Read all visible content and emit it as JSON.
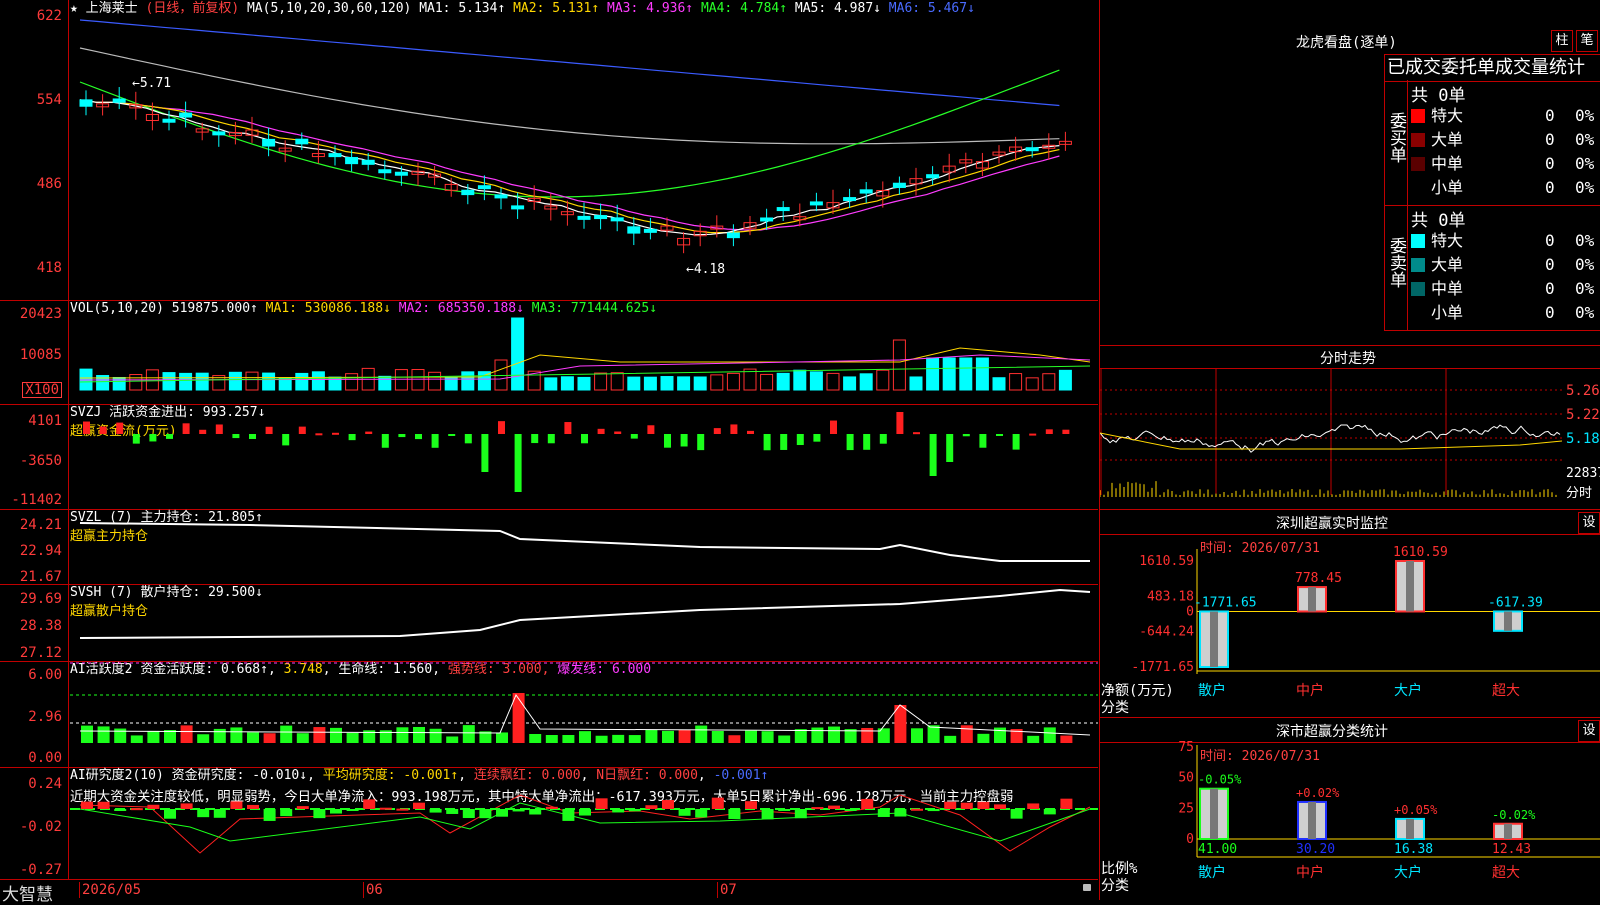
{
  "main": {
    "title_star": "★",
    "stock_name": "上海莱士",
    "period_note": "(日线，前复权)",
    "ma_label": "MA(5,10,20,30,60,120)",
    "ma1": "MA1: 5.134↑",
    "ma2": "MA2: 5.131↑",
    "ma3": "MA3: 4.936↑",
    "ma4": "MA4: 4.784↑",
    "ma5": "MA5: 4.987↓",
    "ma6": "MA6: 5.467↓",
    "ticks": [
      "622",
      "554",
      "486",
      "418"
    ],
    "high_label": "←5.71",
    "low_label": "←4.18"
  },
  "vol": {
    "label": "VOL(5,10,20)",
    "value": "519875.000↑",
    "ma1": "MA1: 530086.188↓",
    "ma2": "MA2: 685350.188↓",
    "ma3": "MA3: 771444.625↓",
    "ticks": [
      "20423",
      "10085",
      "X100"
    ]
  },
  "svzj": {
    "label": "SVZJ",
    "line1": "活跃资金进出: 993.257↓",
    "line2": "超赢资金流(万元)",
    "ticks": [
      "4101",
      "-3650",
      "-11402"
    ]
  },
  "svzl": {
    "label": "SVZL (7)",
    "line1": "主力持仓: 21.805↑",
    "line2": "超赢主力持仓",
    "ticks": [
      "24.21",
      "22.94",
      "21.67"
    ]
  },
  "svsh": {
    "label": "SVSH (7)",
    "line1": "散户持仓: 29.500↓",
    "line2": "超赢散户持仓",
    "ticks": [
      "29.69",
      "28.38",
      "27.12"
    ]
  },
  "ai1": {
    "label": "AI活跃度2",
    "a": "资金活跃度: 0.668↑",
    "b": "3.748",
    "c": "生命线: 1.560",
    "d": "强势线: 3.000",
    "e": "爆发线: 6.000",
    "ticks": [
      "6.00",
      "2.96",
      "0.00"
    ]
  },
  "ai2": {
    "label": "AI研究度2(10)",
    "a": "资金研究度: -0.010↓",
    "b": "平均研究度: -0.001↑",
    "c": "连续飘红: 0.000",
    "d": "N日飘红: 0.000",
    "e": "-0.001↑",
    "desc": "近期大资金关注度较低，明显弱势，今日大单净流入：993.198万元，其中特大单净流出：-617.393万元，大单5日累计净出-696.128万元，当前主力控盘弱",
    "ticks": [
      "0.24",
      "-0.02",
      "-0.27"
    ]
  },
  "footer": {
    "brand": "大智慧",
    "dates": [
      "2026/05",
      "06",
      "07"
    ]
  },
  "lhb": {
    "title": "龙虎看盘(逐单)",
    "btn1": "柱",
    "btn2": "笔",
    "header": "已成交委托单成交量统计",
    "buy_side": "委买单",
    "sell_side": "委卖单",
    "buy_total": "共 0单",
    "sell_total": "共 0单",
    "rows_buy": [
      {
        "name": "特大",
        "val": "0",
        "pct": "0%",
        "color": "#ff0000"
      },
      {
        "name": "大单",
        "val": "0",
        "pct": "0%",
        "color": "#8b0000"
      },
      {
        "name": "中单",
        "val": "0",
        "pct": "0%",
        "color": "#5a0000"
      },
      {
        "name": "小单",
        "val": "0",
        "pct": "0%",
        "color": "#000000"
      }
    ],
    "rows_sell": [
      {
        "name": "特大",
        "val": "0",
        "pct": "0%",
        "color": "#00ffff"
      },
      {
        "name": "大单",
        "val": "0",
        "pct": "0%",
        "color": "#008b8b"
      },
      {
        "name": "中单",
        "val": "0",
        "pct": "0%",
        "color": "#006666"
      },
      {
        "name": "小单",
        "val": "0",
        "pct": "0%",
        "color": "#000000"
      }
    ]
  },
  "intraday": {
    "title": "分时走势",
    "ticks": [
      "5.26",
      "5.22",
      "5.18",
      "22837",
      "分时"
    ]
  },
  "sz_monitor": {
    "title": "深圳超赢实时监控",
    "btn": "设",
    "time": "时间: 2026/07/31",
    "ticks": [
      "1610.59",
      "483.18",
      "0",
      "-644.24",
      "-1771.65"
    ],
    "ylabel1": "净额(万元)",
    "ylabel2": "分类",
    "bars": [
      {
        "cat": "散户",
        "val": -1771.65,
        "label": "-1771.65"
      },
      {
        "cat": "中户",
        "val": 778.45,
        "label": "778.45"
      },
      {
        "cat": "大户",
        "val": 1610.59,
        "label": "1610.59"
      },
      {
        "cat": "超大",
        "val": -617.39,
        "label": "-617.39"
      }
    ]
  },
  "sz_class": {
    "title": "深市超赢分类统计",
    "btn": "设",
    "time": "时间: 2026/07/31",
    "ticks": [
      "75",
      "50",
      "25",
      "0"
    ],
    "ylabel1": "比例%",
    "ylabel2": "分类",
    "bars": [
      {
        "cat": "散户",
        "val": 41.0,
        "label": "41.00",
        "chg": "-0.05%"
      },
      {
        "cat": "中户",
        "val": 30.2,
        "label": "30.20",
        "chg": "+0.02%"
      },
      {
        "cat": "大户",
        "val": 16.38,
        "label": "16.38",
        "chg": "+0.05%"
      },
      {
        "cat": "超大",
        "val": 12.43,
        "label": "12.43",
        "chg": "-0.02%"
      }
    ]
  }
}
